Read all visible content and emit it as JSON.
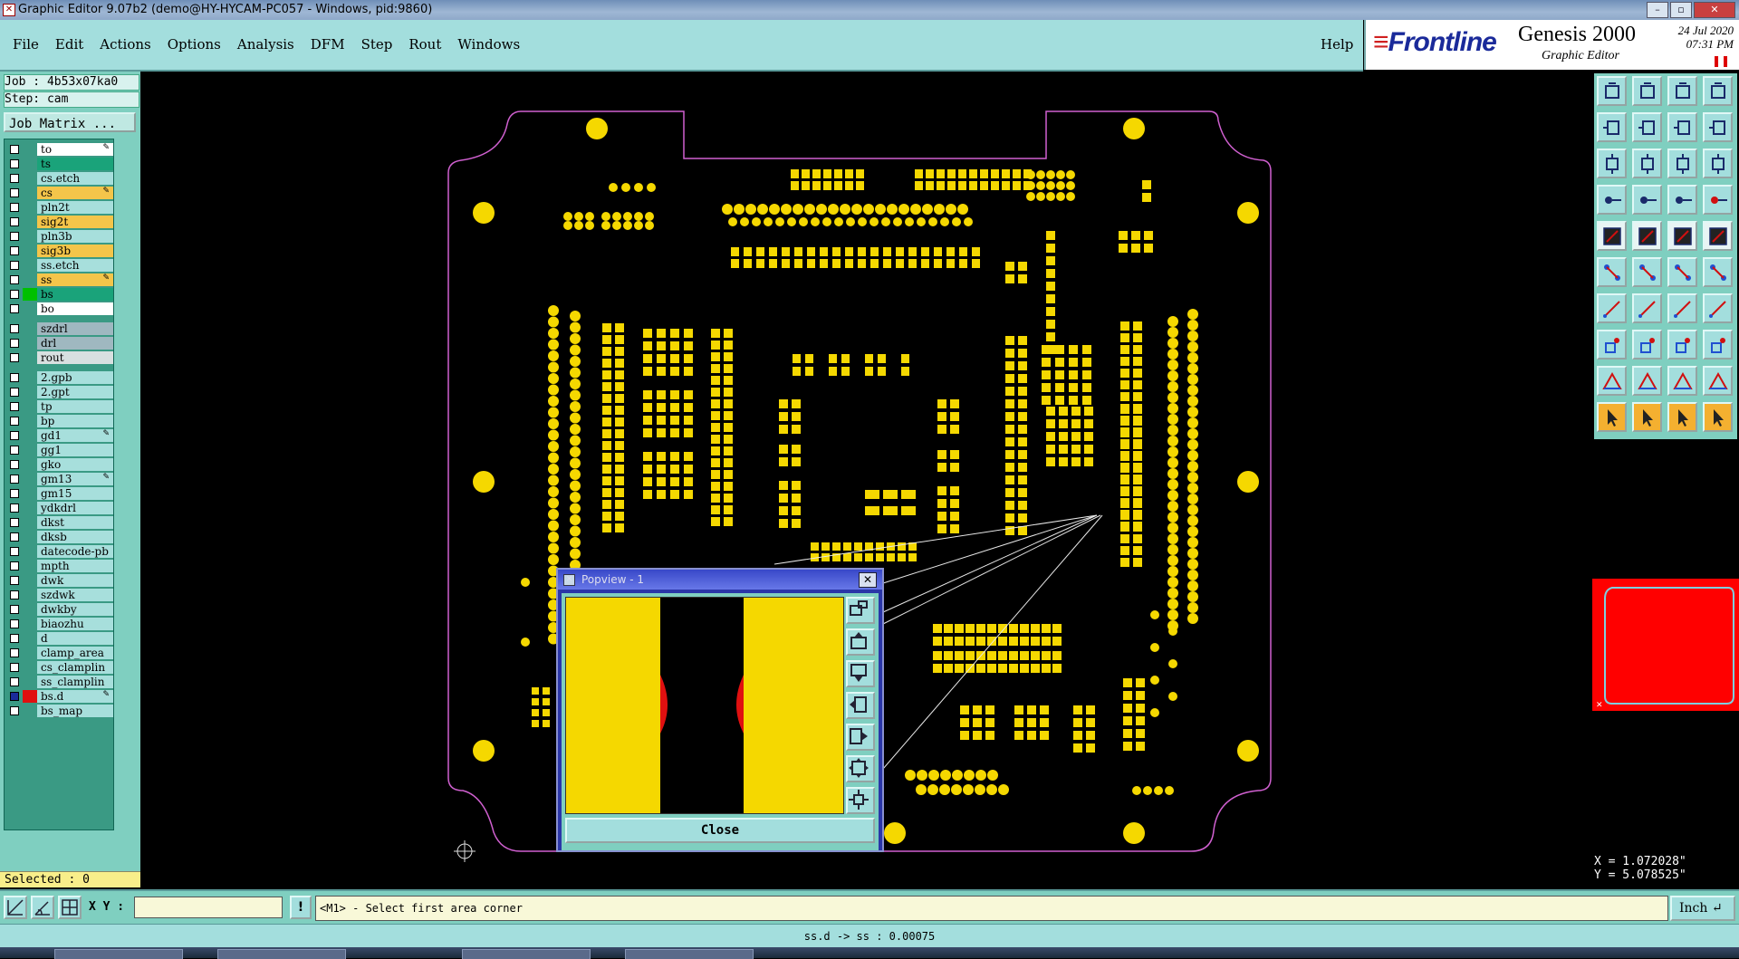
{
  "window": {
    "title": "Graphic Editor 9.07b2 (demo@HY-HYCAM-PC057 - Windows, pid:9860)"
  },
  "menu": {
    "items": [
      "File",
      "Edit",
      "Actions",
      "Options",
      "Analysis",
      "DFM",
      "Step",
      "Rout",
      "Windows"
    ],
    "help": "Help"
  },
  "brand": {
    "logo": "Frontline",
    "product": "Genesis 2000",
    "subtitle": "Graphic Editor",
    "date": "24 Jul 2020",
    "time": "07:31 PM"
  },
  "job": {
    "job_label": "Job : 4b53x07ka0",
    "step_label": "Step: cam",
    "matrix_button": "Job Matrix ..."
  },
  "layers": [
    {
      "name": "to",
      "color": "#ffffff",
      "swatch": "",
      "edit": true
    },
    {
      "name": "ts",
      "color": "#1aa37a",
      "swatch": "",
      "edit": false
    },
    {
      "name": "cs.etch",
      "color": "#a7dfdc",
      "swatch": "",
      "edit": false
    },
    {
      "name": "cs",
      "color": "#f4c54a",
      "swatch": "",
      "edit": true
    },
    {
      "name": "pln2t",
      "color": "#a7dfdc",
      "swatch": "",
      "edit": false
    },
    {
      "name": "sig2t",
      "color": "#f4c54a",
      "swatch": "",
      "edit": false
    },
    {
      "name": "pln3b",
      "color": "#a7dfdc",
      "swatch": "",
      "edit": false
    },
    {
      "name": "sig3b",
      "color": "#f4c54a",
      "swatch": "",
      "edit": false
    },
    {
      "name": "ss.etch",
      "color": "#a7dfdc",
      "swatch": "",
      "edit": false
    },
    {
      "name": "ss",
      "color": "#f4c54a",
      "swatch": "",
      "edit": true
    },
    {
      "name": "bs",
      "color": "#1aa37a",
      "swatch": "#00c000",
      "edit": false
    },
    {
      "name": "bo",
      "color": "#ffffff",
      "swatch": "",
      "edit": false
    },
    {
      "name": "szdrl",
      "color": "#9fb8c0",
      "swatch": "",
      "edit": false
    },
    {
      "name": "drl",
      "color": "#9fb8c0",
      "swatch": "",
      "edit": false
    },
    {
      "name": "rout",
      "color": "#d8e0e0",
      "swatch": "",
      "edit": false
    },
    {
      "name": "2.gpb",
      "color": "#a7dfdc",
      "swatch": "",
      "edit": false
    },
    {
      "name": "2.gpt",
      "color": "#a7dfdc",
      "swatch": "",
      "edit": false
    },
    {
      "name": "tp",
      "color": "#a7dfdc",
      "swatch": "",
      "edit": false
    },
    {
      "name": "bp",
      "color": "#a7dfdc",
      "swatch": "",
      "edit": false
    },
    {
      "name": "gd1",
      "color": "#a7dfdc",
      "swatch": "",
      "edit": true
    },
    {
      "name": "gg1",
      "color": "#a7dfdc",
      "swatch": "",
      "edit": false
    },
    {
      "name": "gko",
      "color": "#a7dfdc",
      "swatch": "",
      "edit": false
    },
    {
      "name": "gm13",
      "color": "#a7dfdc",
      "swatch": "",
      "edit": true
    },
    {
      "name": "gm15",
      "color": "#a7dfdc",
      "swatch": "",
      "edit": false
    },
    {
      "name": "ydkdrl",
      "color": "#a7dfdc",
      "swatch": "",
      "edit": false
    },
    {
      "name": "dkst",
      "color": "#a7dfdc",
      "swatch": "",
      "edit": false
    },
    {
      "name": "dksb",
      "color": "#a7dfdc",
      "swatch": "",
      "edit": false
    },
    {
      "name": "datecode-pb",
      "color": "#a7dfdc",
      "swatch": "",
      "edit": false
    },
    {
      "name": "mpth",
      "color": "#a7dfdc",
      "swatch": "",
      "edit": false
    },
    {
      "name": "dwk",
      "color": "#a7dfdc",
      "swatch": "",
      "edit": false
    },
    {
      "name": "szdwk",
      "color": "#a7dfdc",
      "swatch": "",
      "edit": false
    },
    {
      "name": "dwkby",
      "color": "#a7dfdc",
      "swatch": "",
      "edit": false
    },
    {
      "name": "biaozhu",
      "color": "#a7dfdc",
      "swatch": "",
      "edit": false
    },
    {
      "name": "d",
      "color": "#a7dfdc",
      "swatch": "",
      "edit": false
    },
    {
      "name": "clamp_area",
      "color": "#a7dfdc",
      "swatch": "",
      "edit": false
    },
    {
      "name": "cs_clamplin",
      "color": "#a7dfdc",
      "swatch": "",
      "edit": false
    },
    {
      "name": "ss_clamplin",
      "color": "#a7dfdc",
      "swatch": "",
      "edit": false
    },
    {
      "name": "bs.d",
      "color": "#a7dfdc",
      "swatch": "#e01010",
      "edit": true
    },
    {
      "name": "bs_map",
      "color": "#a7dfdc",
      "swatch": "",
      "edit": false
    }
  ],
  "selected": "Selected : 0",
  "popview": {
    "title": "Popview - 1",
    "close_label": "Close"
  },
  "coords": {
    "x": "X = 1.072028\"",
    "y": "Y = 5.078525\""
  },
  "command": {
    "xy_label": "X Y :",
    "xy_value": "",
    "bang": "!",
    "prompt": "<M1> - Select first area corner",
    "unit": "Inch"
  },
  "status": "ss.d -> ss : 0.00075",
  "colors": {
    "pad": "#f5d800",
    "profile": "#d060d0",
    "panel": "#7fcfc0",
    "menu": "#a3dedd",
    "highlight": "#ff0000"
  }
}
